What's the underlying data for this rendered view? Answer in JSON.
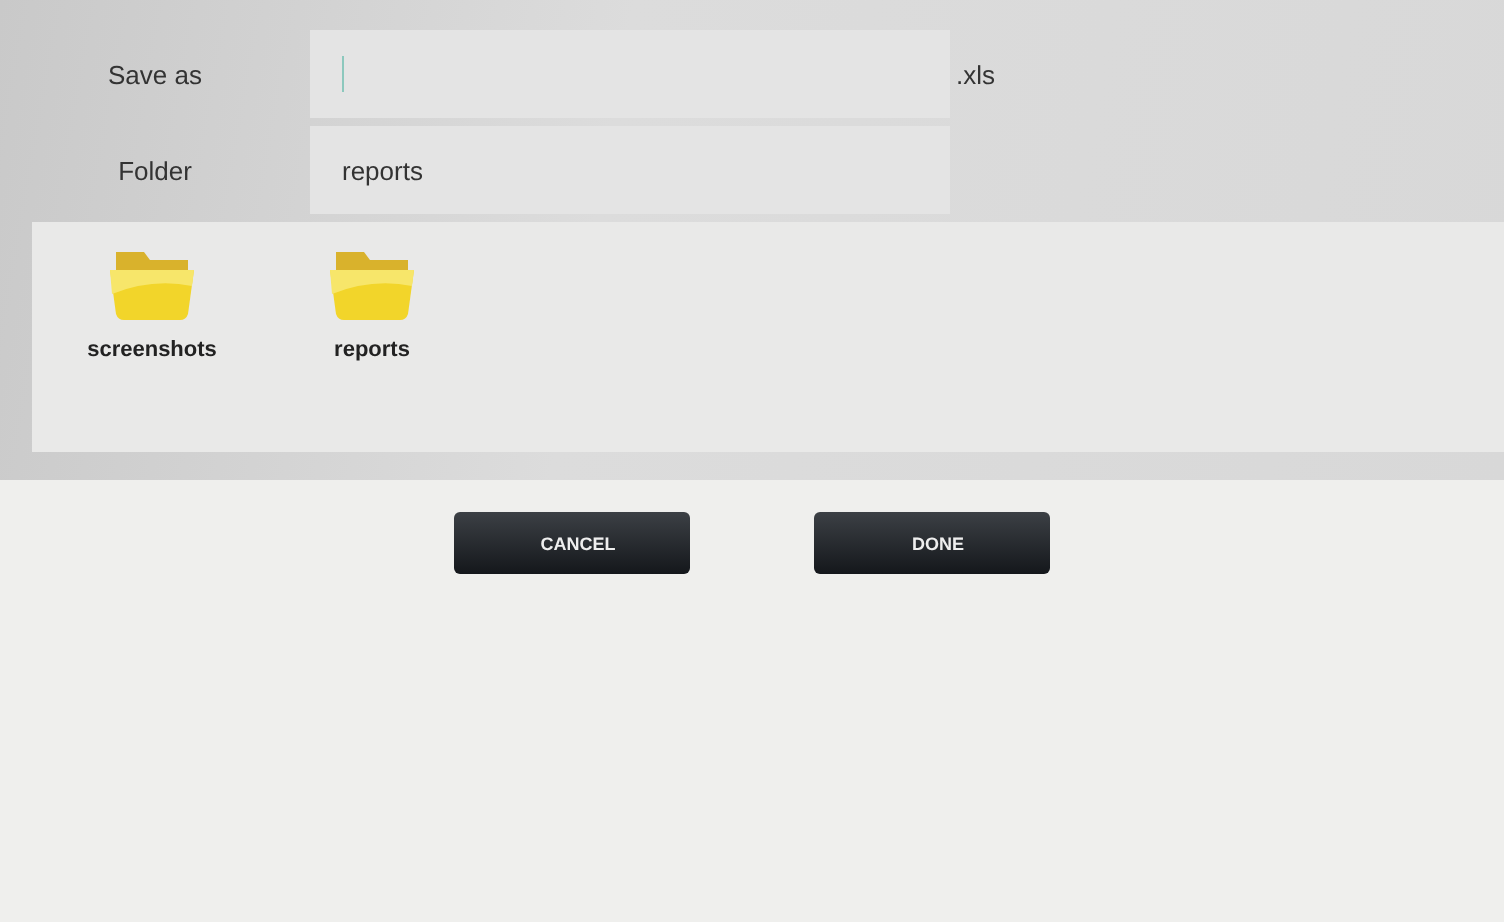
{
  "form": {
    "save_as": {
      "label": "Save as",
      "focused": true,
      "suffix": ".xls"
    },
    "folder": {
      "label": "Folder",
      "value": "reports"
    }
  },
  "folders": [
    {
      "name": "screenshots"
    },
    {
      "name": "reports"
    }
  ],
  "buttons": [
    {
      "label": "CANCEL"
    },
    {
      "label": "DONE"
    }
  ]
}
